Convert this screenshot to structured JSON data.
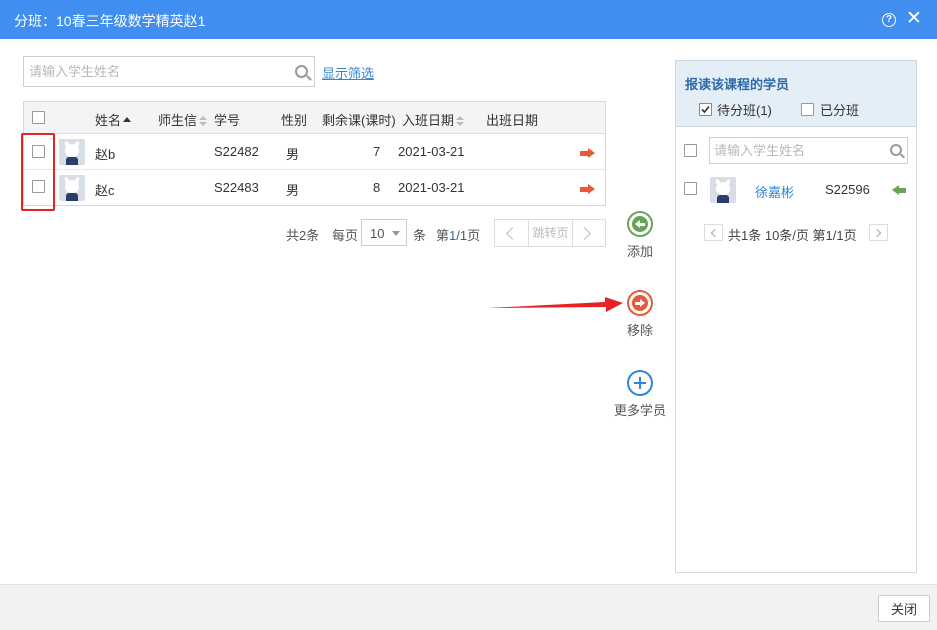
{
  "dialog": {
    "title": "分班：10春三年级数学精英赵1",
    "help_icon": "?",
    "close_icon": "✕"
  },
  "search": {
    "placeholder": "请输入学生姓名",
    "filter_link": "显示筛选"
  },
  "table": {
    "columns": [
      "姓名",
      "师生信",
      "学号",
      "性别",
      "剩余课(课时)",
      "入班日期",
      "出班日期"
    ],
    "rows": [
      {
        "name": "赵b",
        "student_id": "S22482",
        "gender": "男",
        "remaining": "7",
        "enter_date": "2021-03-21",
        "exit_date": ""
      },
      {
        "name": "赵c",
        "student_id": "S22483",
        "gender": "男",
        "remaining": "8",
        "enter_date": "2021-03-21",
        "exit_date": ""
      }
    ]
  },
  "pager": {
    "total": "共2条",
    "per_page_label": "每页",
    "per_page": "10",
    "unit": "条",
    "page_prefix": "第",
    "page_current": "1",
    "page_suffix": "/1页",
    "jump": "跳转页"
  },
  "actions": {
    "add": "添加",
    "remove": "移除",
    "more": "更多学员"
  },
  "right_panel": {
    "title": "报读该课程的学员",
    "tab_pending": "待分班(1)",
    "tab_assigned": "已分班",
    "search_placeholder": "请输入学生姓名",
    "students": [
      {
        "name": "徐嘉彬",
        "student_id": "S22596"
      }
    ],
    "pager_text": "共1条 10条/页 第1/1页"
  },
  "footer": {
    "close": "关闭"
  },
  "colors": {
    "title_bar": "#3f8ef0",
    "link": "#2f86d6",
    "add": "#67a45a",
    "remove": "#e8593a",
    "highlight": "#e82222"
  }
}
